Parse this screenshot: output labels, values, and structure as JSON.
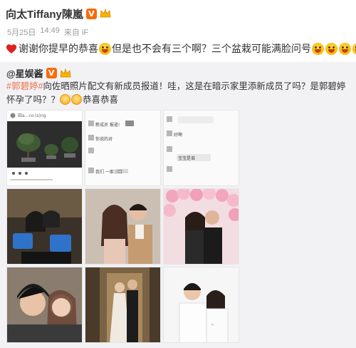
{
  "post": {
    "user_name": "向太Tiffany陳嵐",
    "vip_badge": "V",
    "date": "5月25日",
    "time": "14:49",
    "source": "来自 iF",
    "text_before_emoji": "谢谢你提早的恭喜",
    "text_after_emoji": "但是也不会有三个啊？三个盆栽可能满脸问号"
  },
  "repost": {
    "user_handle": "@星娱酱",
    "vip_badge": "V",
    "topic": "#郭碧婷#",
    "text": "向佐晒照片配文有新成员报道！哇，这是在暗示家里添新成员了吗？是郭碧婷怀孕了吗？？",
    "closing_text": "恭喜恭喜",
    "tiles": [
      {
        "name": "tile-bonsai-post"
      },
      {
        "name": "tile-chat-screenshot-1"
      },
      {
        "name": "tile-chat-screenshot-2"
      },
      {
        "name": "tile-thumbs-up-photo"
      },
      {
        "name": "tile-couple-photo"
      },
      {
        "name": "tile-balloon-photo"
      },
      {
        "name": "tile-selfie-photo"
      },
      {
        "name": "tile-gala-photo"
      },
      {
        "name": "tile-white-tee-photo"
      }
    ],
    "tile_texts": {
      "ig_handle": "田a...co.(s)ng",
      "chat1_line1": "新成员 报道!",
      "chat1_line2": "你说的对",
      "chat1_line3": "我们 一家三口",
      "chat2_line1": "好啊",
      "chat2_line2": "宝宝是谁"
    }
  },
  "colors": {
    "accent": "#eb7350",
    "vip_orange": "#f56c0c",
    "repost_bg": "#f2f2f5",
    "meta_gray": "#9b9b9b"
  }
}
